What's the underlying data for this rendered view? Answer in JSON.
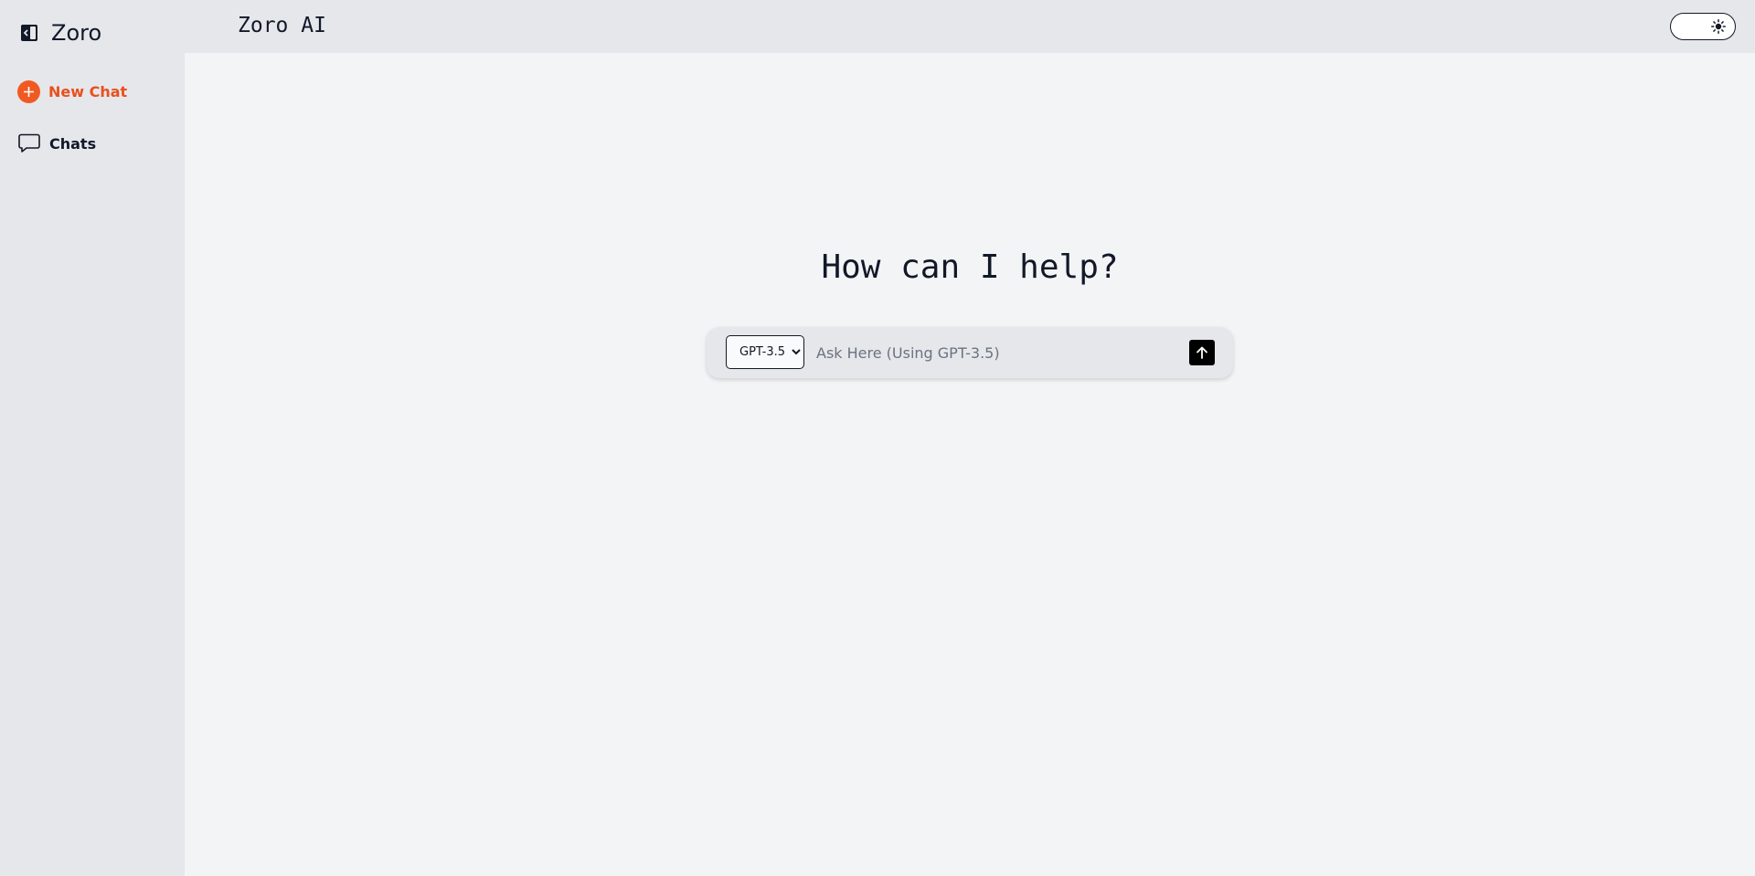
{
  "sidebar": {
    "brand": "Zoro",
    "toggle_icon": "sidebar-toggle-icon",
    "items": [
      {
        "label": "New Chat",
        "icon": "plus-circle-icon",
        "color": "#e8501e"
      },
      {
        "label": "Chats",
        "icon": "chat-bubble-icon"
      }
    ]
  },
  "header": {
    "title": "Zoro AI",
    "theme_toggle_icon": "sun-icon"
  },
  "main": {
    "heading": "How can I help?",
    "composer": {
      "model_options": [
        "GPT-3.5"
      ],
      "selected_model": "GPT-3.5",
      "placeholder": "Ask Here (Using GPT-3.5)",
      "value": "",
      "send_icon": "arrow-up-icon"
    }
  },
  "colors": {
    "accent": "#f05a22",
    "sidebar_bg": "#e5e7eb",
    "main_bg": "#f3f4f6"
  }
}
